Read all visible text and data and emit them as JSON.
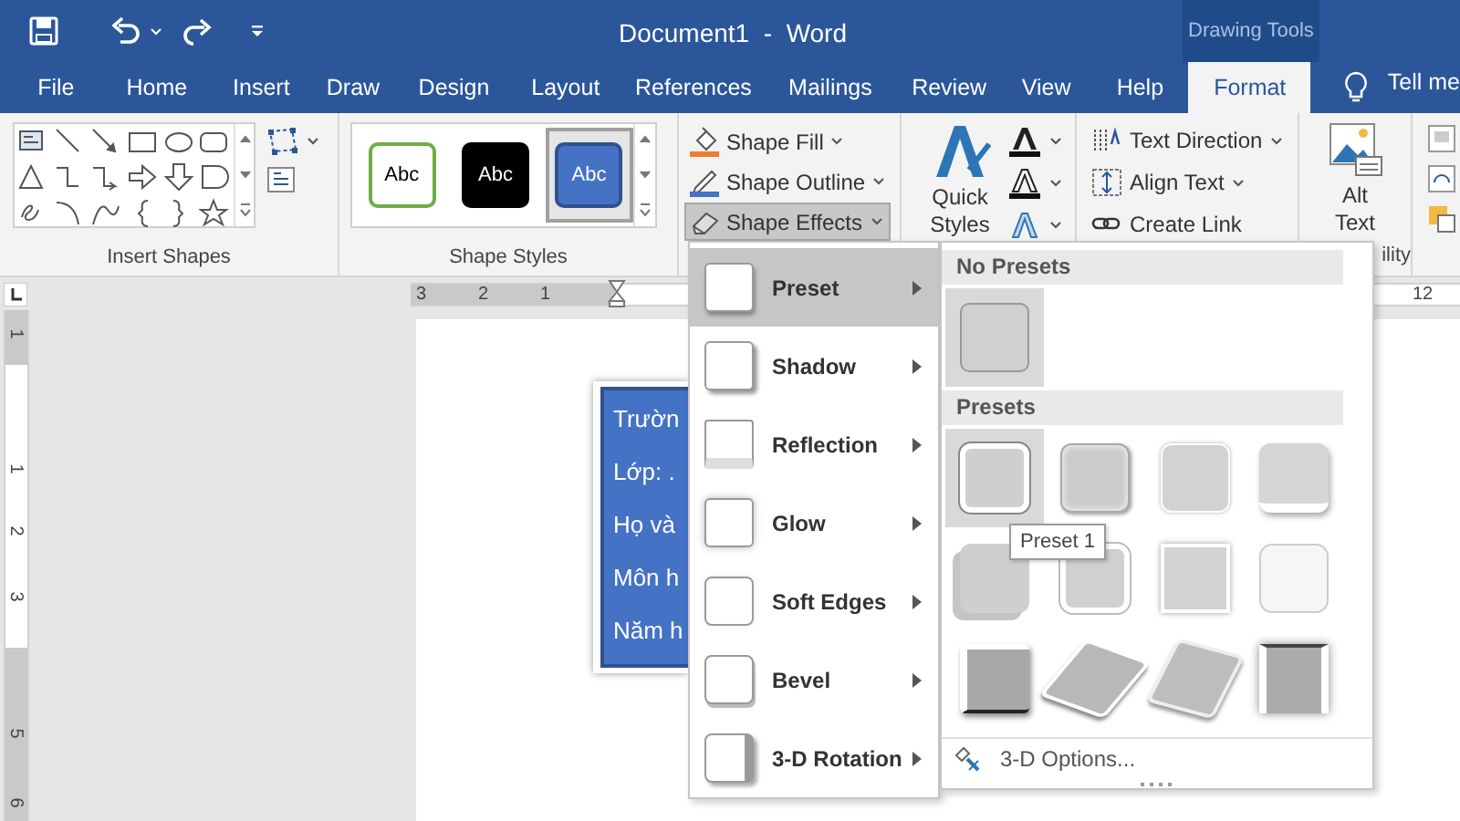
{
  "window": {
    "title": "Document1  -  Word",
    "contextual_group": "Drawing Tools"
  },
  "tabs": [
    {
      "label": "File",
      "selected": false
    },
    {
      "label": "Home",
      "selected": false
    },
    {
      "label": "Insert",
      "selected": false
    },
    {
      "label": "Draw",
      "selected": false
    },
    {
      "label": "Design",
      "selected": false
    },
    {
      "label": "Layout",
      "selected": false
    },
    {
      "label": "References",
      "selected": false
    },
    {
      "label": "Mailings",
      "selected": false
    },
    {
      "label": "Review",
      "selected": false
    },
    {
      "label": "View",
      "selected": false
    },
    {
      "label": "Help",
      "selected": false
    },
    {
      "label": "Format",
      "selected": true
    }
  ],
  "tell_me": "Tell me",
  "ribbon": {
    "insert_shapes_label": "Insert Shapes",
    "shape_styles": {
      "label": "Shape Styles",
      "samples": [
        {
          "text": "Abc",
          "kind": "outline",
          "selected": false
        },
        {
          "text": "Abc",
          "kind": "dark",
          "selected": false
        },
        {
          "text": "Abc",
          "kind": "filled",
          "selected": true
        }
      ]
    },
    "shape_commands": [
      {
        "label": "Shape Fill",
        "pressed": false
      },
      {
        "label": "Shape Outline",
        "pressed": false
      },
      {
        "label": "Shape Effects",
        "pressed": true
      }
    ],
    "quick_styles": "Quick Styles",
    "text_commands": [
      "Text Direction",
      "Align Text",
      "Create Link"
    ],
    "alt_text": "Alt Text",
    "accessibility_label": "ility"
  },
  "ruler": {
    "horizontal": [
      "3",
      "2",
      "1",
      "12"
    ],
    "vertical": [
      "1",
      "1",
      "2",
      "3",
      "5",
      "6"
    ]
  },
  "text_box_lines": [
    "Trườn",
    "Lớp: .",
    "Họ và",
    "Môn h",
    "Năm h"
  ],
  "effects_menu": [
    {
      "label": "Preset",
      "selected": true
    },
    {
      "label": "Shadow",
      "selected": false
    },
    {
      "label": "Reflection",
      "selected": false
    },
    {
      "label": "Glow",
      "selected": false
    },
    {
      "label": "Soft Edges",
      "selected": false
    },
    {
      "label": "Bevel",
      "selected": false
    },
    {
      "label": "3-D Rotation",
      "selected": false
    }
  ],
  "preset_gallery": {
    "no_presets_heading": "No Presets",
    "no_presets": [
      {
        "highlighted": true
      }
    ],
    "presets_heading": "Presets",
    "presets": [
      {
        "highlighted": true
      },
      {
        "highlighted": false
      },
      {
        "highlighted": false
      },
      {
        "highlighted": false
      },
      {
        "highlighted": false
      },
      {
        "highlighted": false
      },
      {
        "highlighted": false
      },
      {
        "highlighted": false
      },
      {
        "highlighted": false
      },
      {
        "highlighted": false
      },
      {
        "highlighted": false
      },
      {
        "highlighted": false
      }
    ],
    "tooltip": "Preset 1",
    "options": "3-D Options..."
  }
}
